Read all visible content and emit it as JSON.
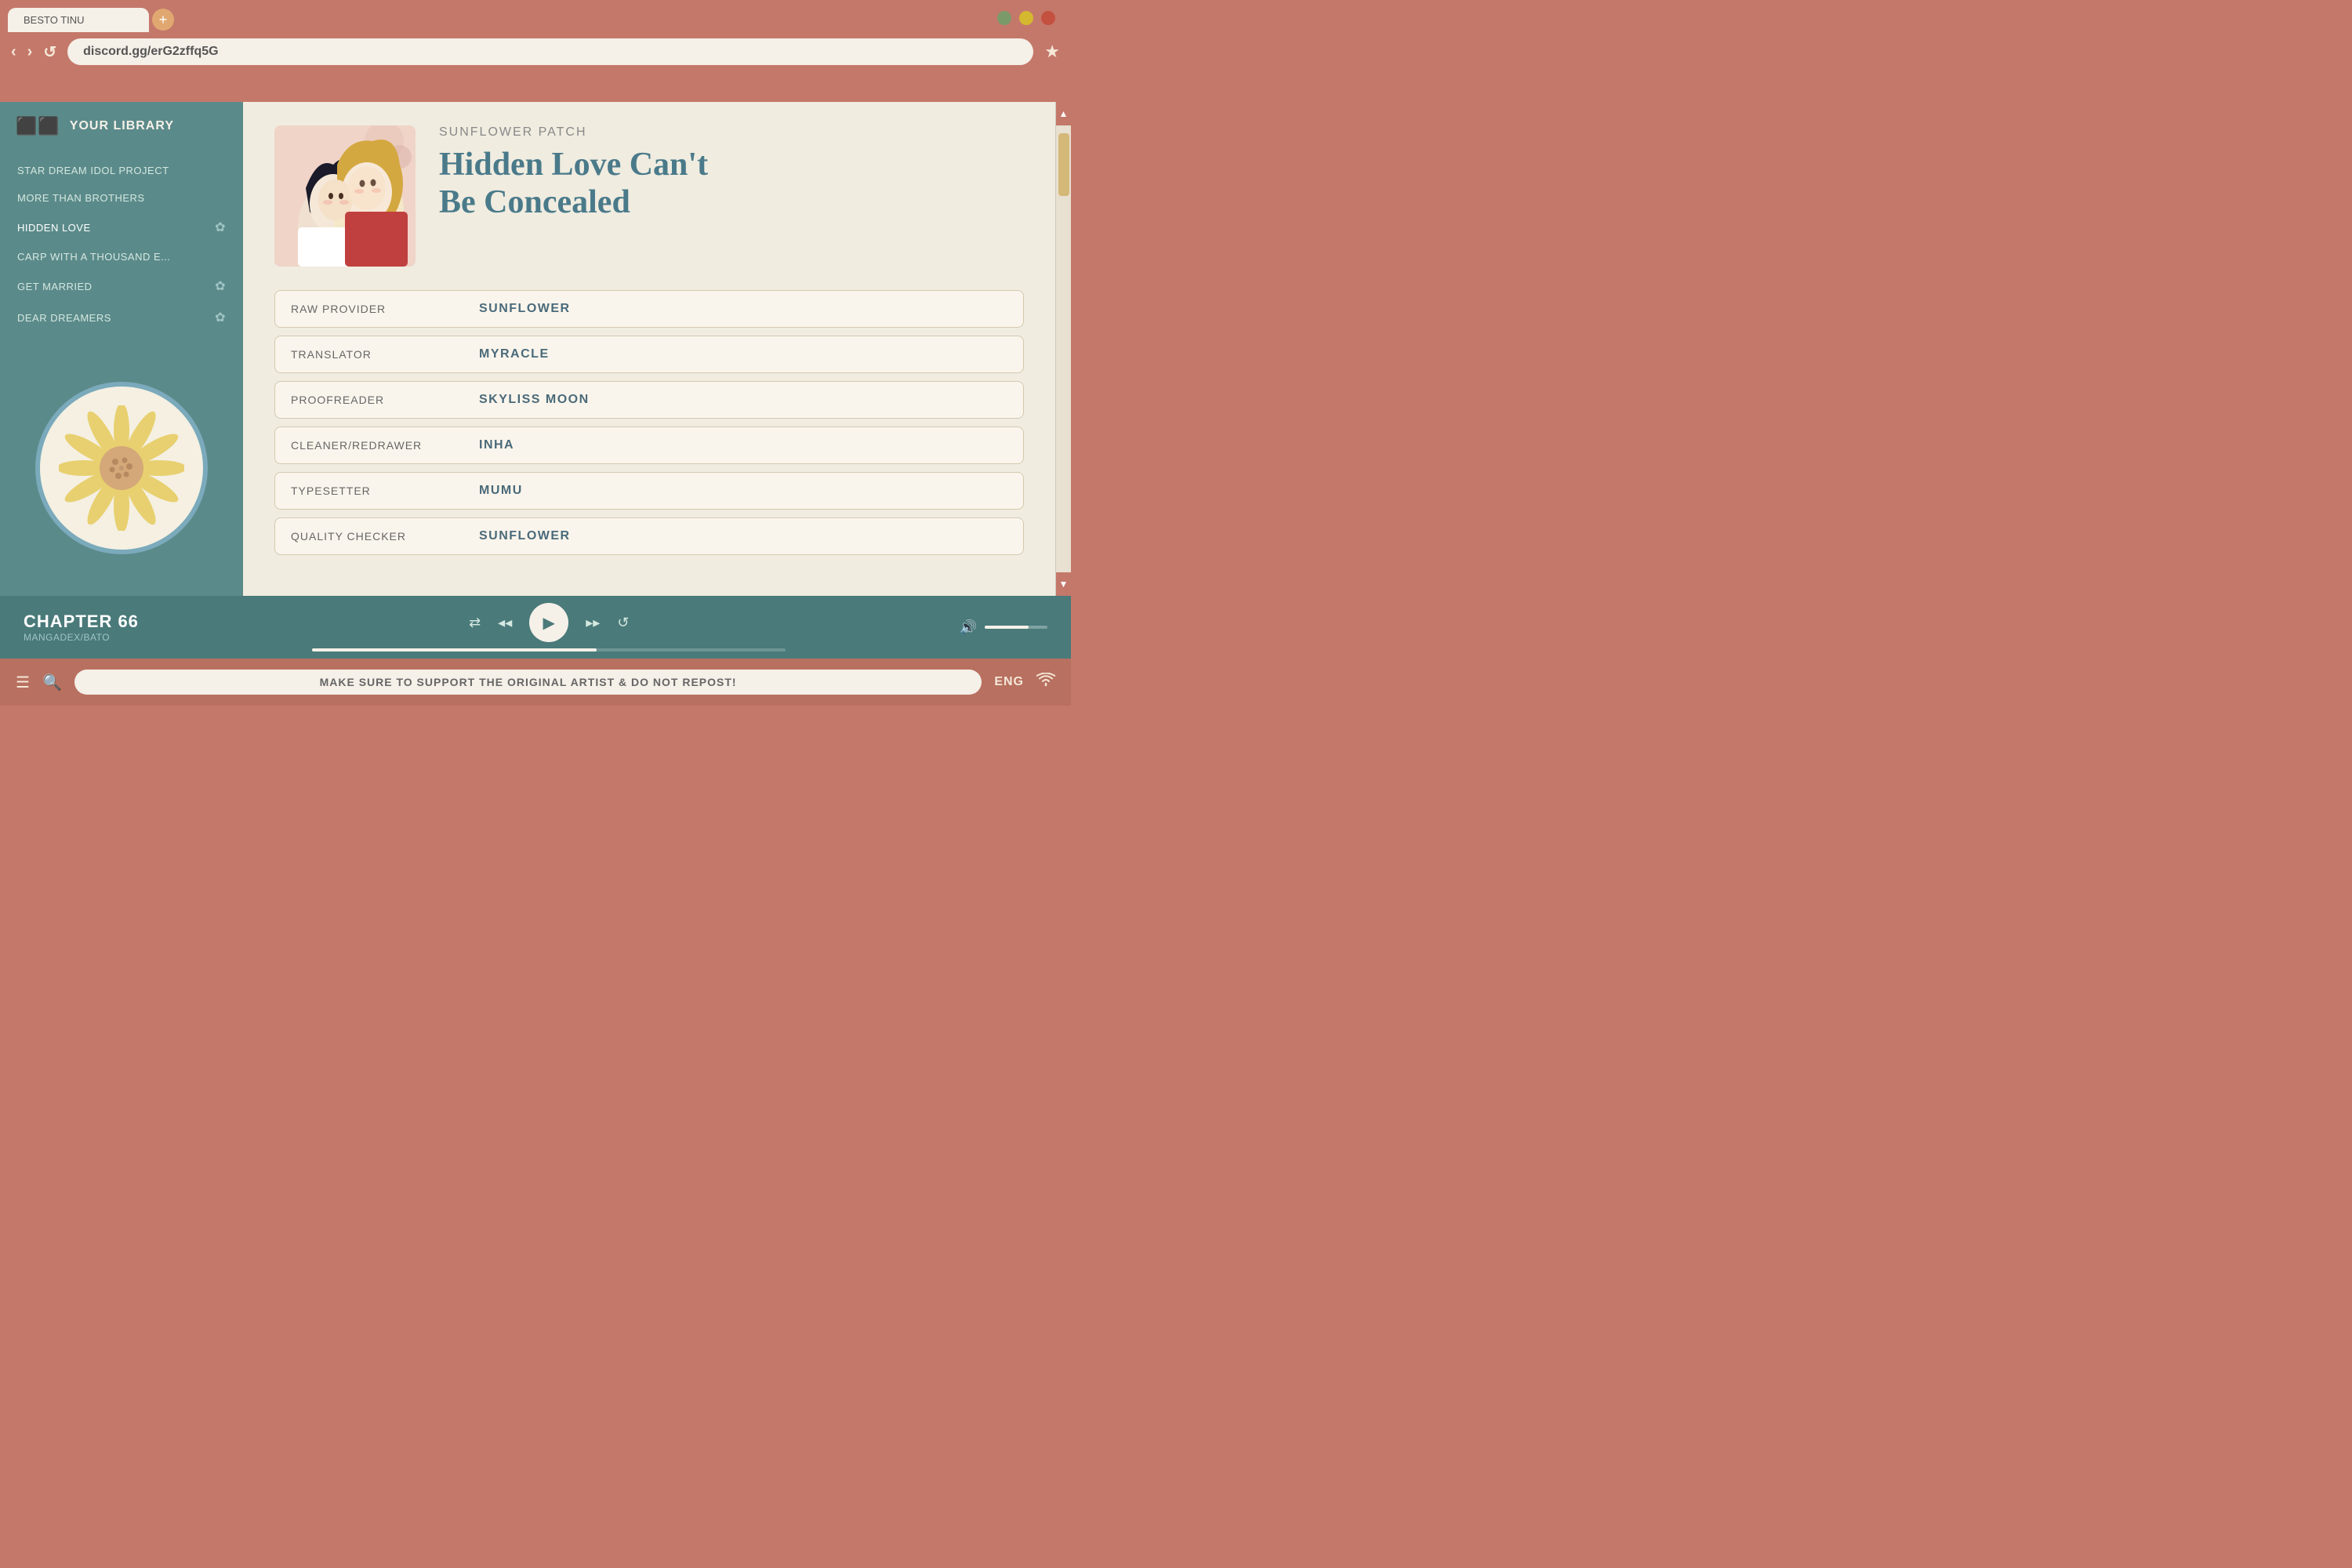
{
  "browser": {
    "tab_label": "BESTO TINU",
    "tab_add_icon": "+",
    "url": "discord.gg/erG2zffq5G",
    "window_controls": [
      {
        "color": "#7a9a6a",
        "name": "minimize"
      },
      {
        "color": "#d4b830",
        "name": "maximize"
      },
      {
        "color": "#c45040",
        "name": "close"
      }
    ],
    "nav_back": "‹",
    "nav_forward": "›",
    "nav_refresh": "↺",
    "star": "★"
  },
  "sidebar": {
    "library_label": "YOUR LIBRARY",
    "items": [
      {
        "label": "STAR DREAM IDOL PROJECT",
        "heart": false
      },
      {
        "label": "MORE THAN BROTHERS",
        "heart": false
      },
      {
        "label": "HIDDEN LOVE",
        "heart": true
      },
      {
        "label": "CARP WITH A THOUSAND E...",
        "heart": false
      },
      {
        "label": "GET MARRIED",
        "heart": true
      },
      {
        "label": "DEAR DREAMERS",
        "heart": true
      }
    ]
  },
  "manga": {
    "scanlator": "SUNFLOWER PATCH",
    "title_line1": "Hidden Love Can't",
    "title_line2": "Be Concealed",
    "credits": [
      {
        "label": "RAW PROVIDER",
        "value": "SUNFLOWER"
      },
      {
        "label": "TRANSLATOR",
        "value": "MYRACLE"
      },
      {
        "label": "PROOFREADER",
        "value": "SKYLISS MOON"
      },
      {
        "label": "CLEANER/REDRAWER",
        "value": "INHA"
      },
      {
        "label": "TYPESETTER",
        "value": "MUMU"
      },
      {
        "label": "QUALITY CHECKER",
        "value": "SUNFLOWER"
      }
    ]
  },
  "player": {
    "chapter_number": "CHAPTER 66",
    "chapter_source": "MANGADEX/BATO",
    "controls": {
      "shuffle": "⇄",
      "prev": "◂◂",
      "play": "▶",
      "next": "▸▸",
      "repeat": "↺"
    },
    "volume_icon": "🔊"
  },
  "bottom_bar": {
    "menu_icon": "☰",
    "search_icon": "🔍",
    "notice": "MAKE SURE TO SUPPORT THE ORIGINAL ARTIST & DO NOT REPOST!",
    "language": "ENG",
    "wifi_icon": "wifi"
  }
}
